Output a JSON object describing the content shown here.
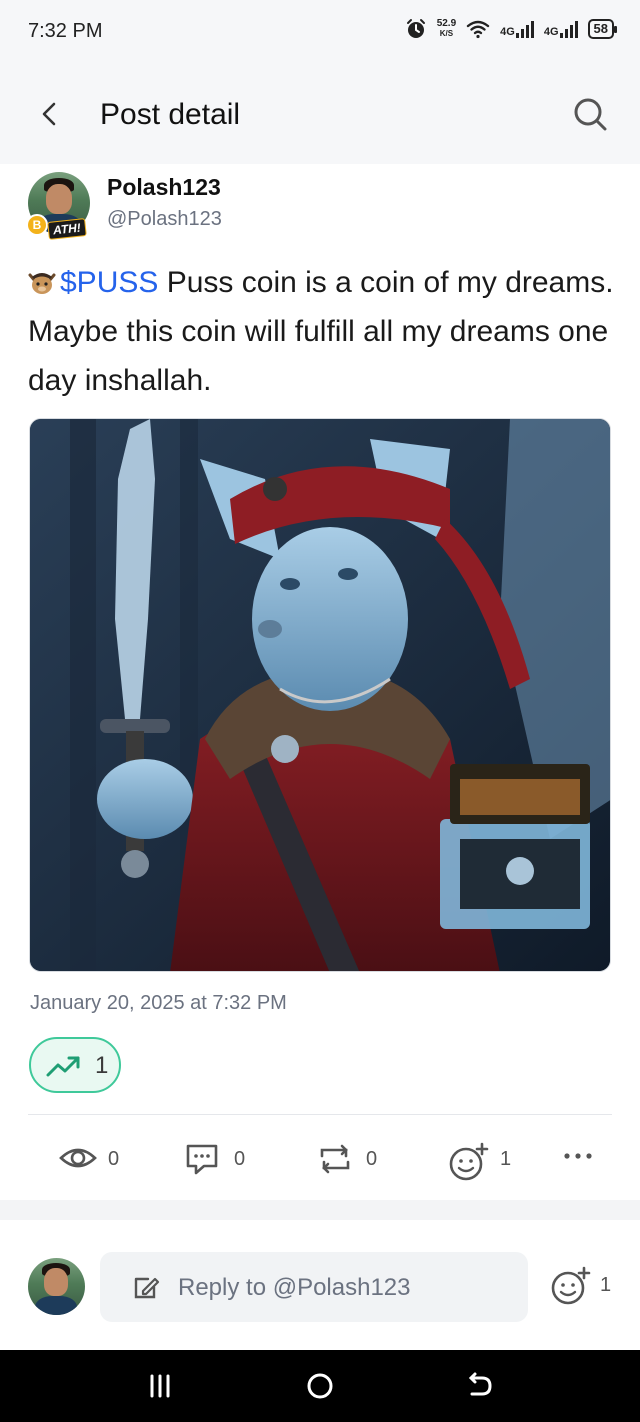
{
  "status_bar": {
    "time": "7:32 PM",
    "speed_value": "52.9",
    "speed_unit": "K/S",
    "network1": "4G",
    "network2": "4G",
    "battery": "58",
    "icons": [
      "alarm-icon",
      "wifi-icon",
      "signal-icon",
      "signal-icon",
      "battery-icon"
    ]
  },
  "header": {
    "title": "Post detail",
    "back_icon": "chevron-left-icon",
    "search_icon": "search-icon"
  },
  "post": {
    "display_name": "Polash123",
    "handle": "@Polash123",
    "badge_text": "ATH!",
    "coin_badge_symbol": "B",
    "ticker": "$PUSS",
    "body": " Puss coin is a coin of my dreams. Maybe this coin will fulfill all my dreams one day inshallah.",
    "ticker_emoji": "puss-cat-emoji",
    "image_description_icon": "post-image",
    "date": "January 20, 2025 at 7:32 PM",
    "trend_count": "1",
    "trend_color": "#3fc99a"
  },
  "actions": {
    "views": "0",
    "comments": "0",
    "reposts": "0",
    "reactions": "1",
    "more_icon": "more-horizontal-icon"
  },
  "reply": {
    "placeholder": "Reply to @Polash123",
    "reaction_count": "1"
  },
  "colors": {
    "accent": "#2563eb",
    "trend": "#3fc99a",
    "muted": "#6b7280"
  }
}
